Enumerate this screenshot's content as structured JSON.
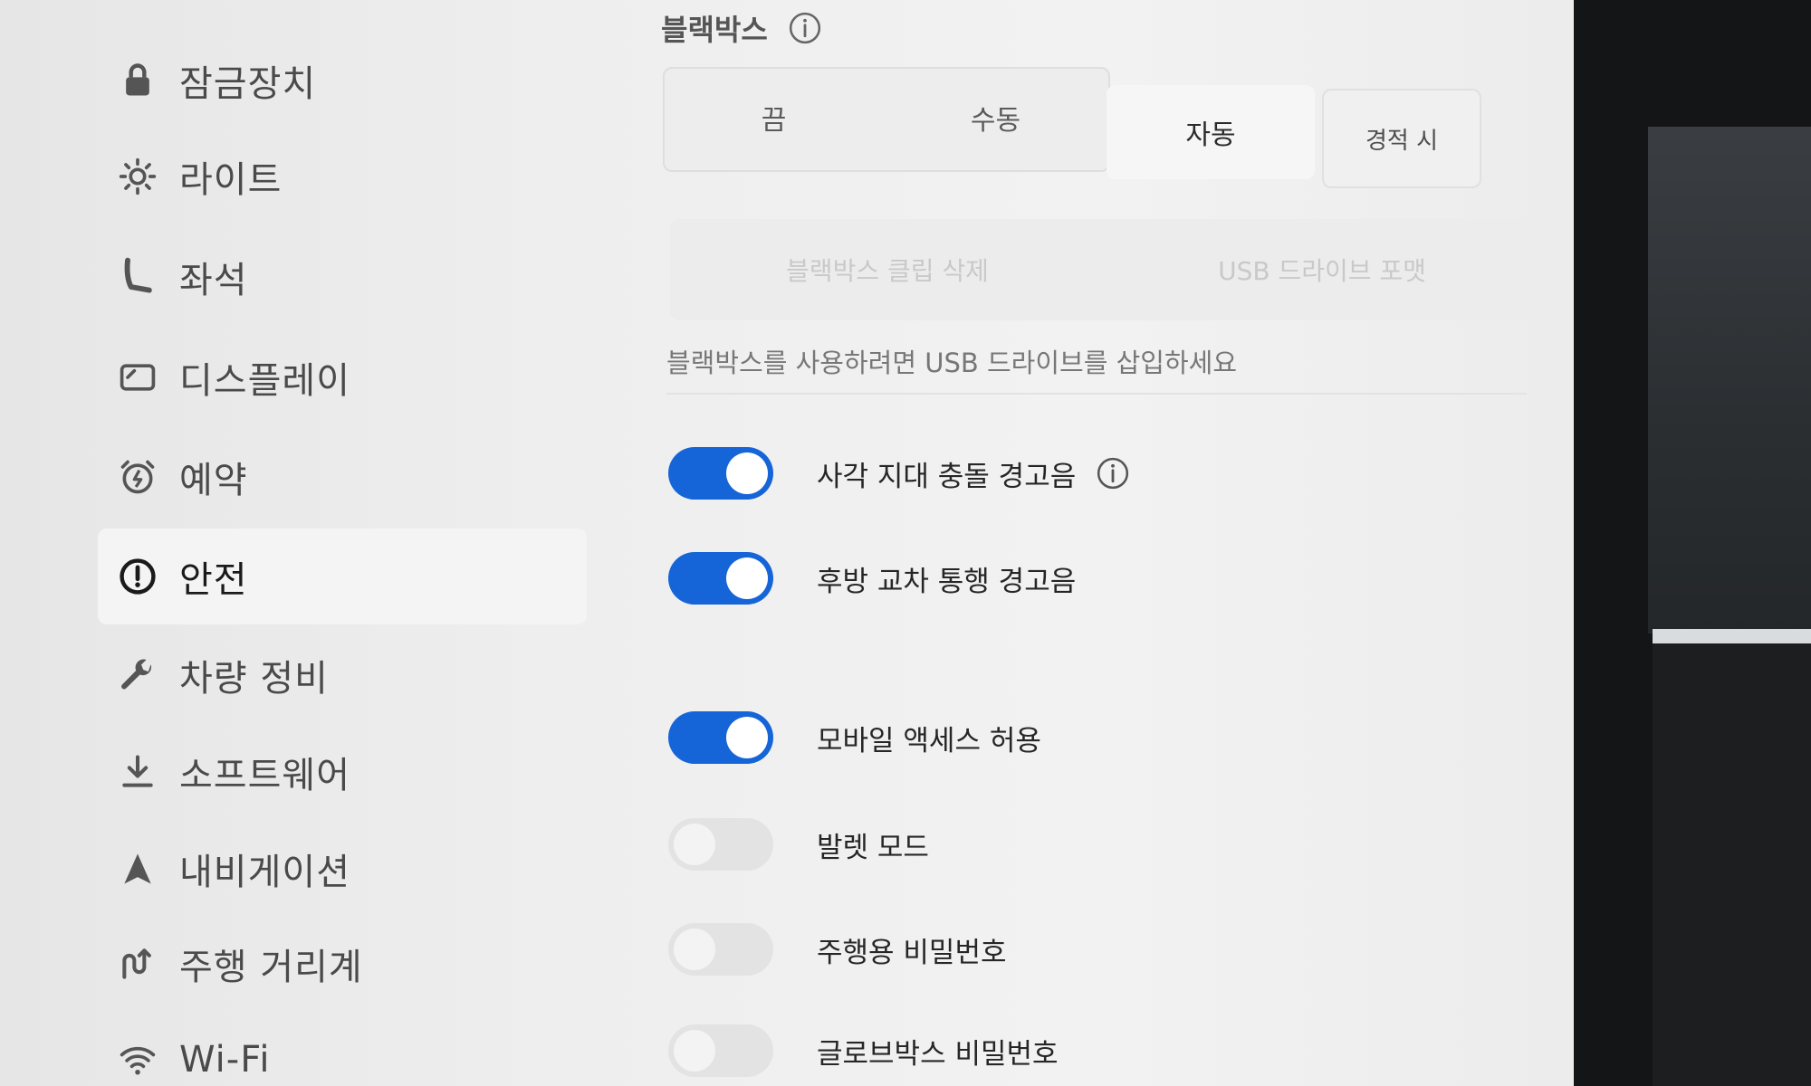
{
  "sidebar": {
    "items": [
      {
        "label": "잠금장치",
        "icon": "lock-icon"
      },
      {
        "label": "라이트",
        "icon": "light-icon"
      },
      {
        "label": "좌석",
        "icon": "seat-icon"
      },
      {
        "label": "디스플레이",
        "icon": "display-icon"
      },
      {
        "label": "예약",
        "icon": "alarm-clock-icon"
      },
      {
        "label": "안전",
        "icon": "alert-circle-icon",
        "active": true
      },
      {
        "label": "차량 정비",
        "icon": "wrench-icon"
      },
      {
        "label": "소프트웨어",
        "icon": "download-icon"
      },
      {
        "label": "내비게이션",
        "icon": "navigation-arrow-icon"
      },
      {
        "label": "주행 거리계",
        "icon": "trip-icon"
      },
      {
        "label": "Wi-Fi",
        "icon": "wifi-icon"
      }
    ]
  },
  "dashcam": {
    "title": "블랙박스",
    "options": [
      "끔",
      "수동",
      "자동",
      "경적 시"
    ],
    "selected": "자동",
    "actions": [
      "블랙박스 클립 삭제",
      "USB 드라이브 포맷"
    ],
    "hint": "블랙박스를 사용하려면 USB 드라이브를 삽입하세요"
  },
  "toggles": [
    {
      "label": "사각 지대 충돌 경고음",
      "on": true,
      "info": true
    },
    {
      "label": "후방 교차 통행 경고음",
      "on": true
    },
    {
      "label": "모바일 액세스 허용",
      "on": true
    },
    {
      "label": "발렛 모드",
      "on": false
    },
    {
      "label": "주행용 비밀번호",
      "on": false
    },
    {
      "label": "글로브박스 비밀번호",
      "on": false
    }
  ],
  "colors": {
    "accent": "#1565d8",
    "toggle_off": "#e3e3e3"
  }
}
